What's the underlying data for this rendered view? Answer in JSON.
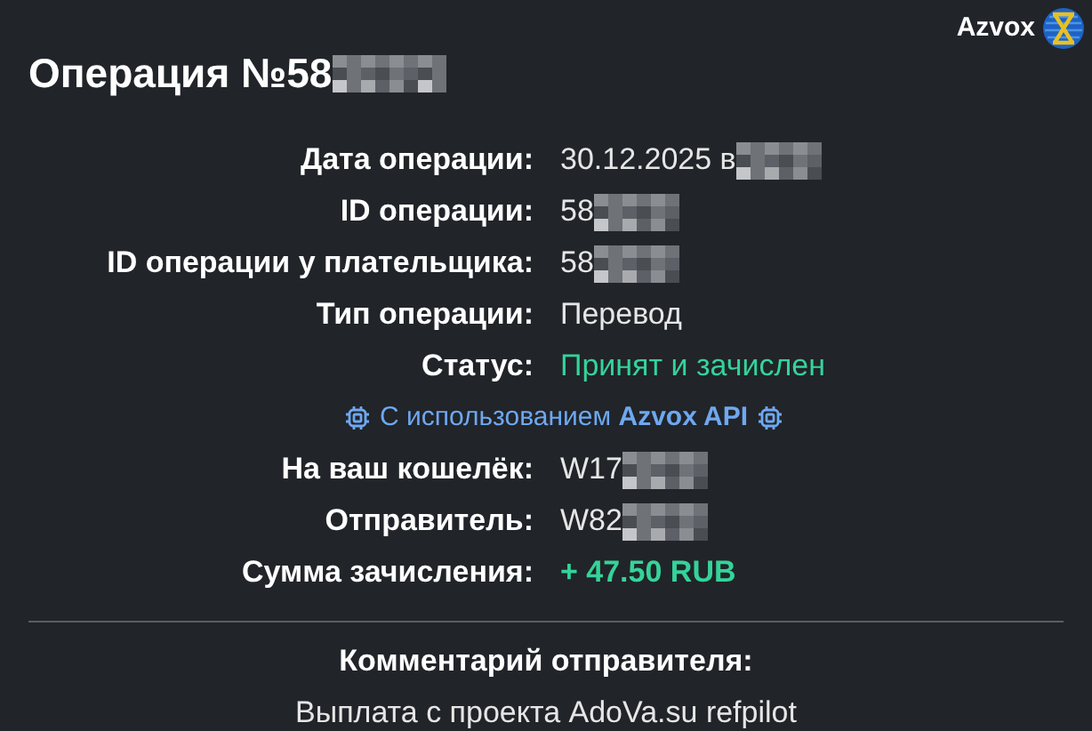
{
  "header": {
    "title": "Операция №58",
    "title_redacted": true,
    "brand": "Azvox"
  },
  "rows": [
    {
      "kind": "text",
      "label": "Дата операции:",
      "value": "30.12.2025 в",
      "redacted": true
    },
    {
      "kind": "text",
      "label": "ID операции:",
      "value": "58",
      "redacted": true
    },
    {
      "kind": "text",
      "label": "ID операции у плательщика:",
      "value": "58",
      "redacted": true
    },
    {
      "kind": "text",
      "label": "Тип операции:",
      "value": "Перевод"
    },
    {
      "kind": "status",
      "label": "Статус:",
      "value": "Принят и зачислен"
    },
    {
      "kind": "api",
      "prefix": "С использованием",
      "name": "Azvox API"
    },
    {
      "kind": "text",
      "label": "На ваш кошелёк:",
      "value": "W17",
      "redacted": true
    },
    {
      "kind": "text",
      "label": "Отправитель:",
      "value": "W82",
      "redacted": true
    },
    {
      "kind": "amount",
      "label": "Сумма зачисления:",
      "value": "+ 47.50 RUB"
    }
  ],
  "comment": {
    "heading": "Комментарий отправителя:",
    "text": "Выплата с проекта AdoVa.su refpilot"
  }
}
